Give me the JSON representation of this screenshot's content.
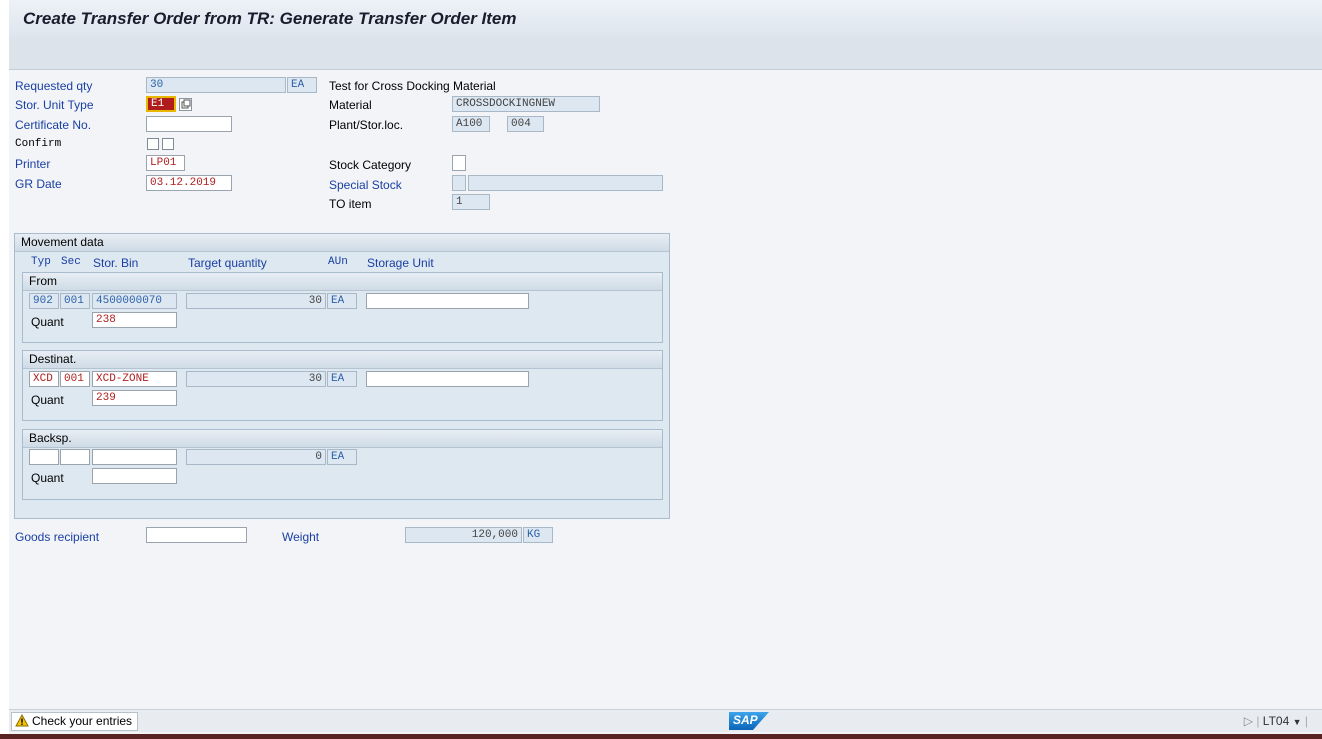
{
  "window": {
    "title": "Create Transfer Order from TR: Generate Transfer Order Item"
  },
  "header": {
    "requested_qty_label": "Requested qty",
    "requested_qty_value": "30",
    "requested_qty_unit": "EA",
    "material_description": "Test  for Cross Docking Material",
    "stor_unit_type_label": "Stor. Unit Type",
    "stor_unit_type_value": "E1",
    "certificate_label": "Certificate No.",
    "certificate_value": "",
    "confirm_label": "Confirm",
    "printer_label": "Printer",
    "printer_value": "LP01",
    "gr_date_label": "GR Date",
    "gr_date_value": "03.12.2019",
    "material_label": "Material",
    "material_value": "CROSSDOCKINGNEW",
    "plant_label": "Plant/Stor.loc.",
    "plant_value": "A100",
    "stor_loc_value": "004",
    "stock_category_label": "Stock Category",
    "special_stock_label": "Special Stock",
    "to_item_label": "TO item",
    "to_item_value": "1"
  },
  "movement": {
    "title": "Movement data",
    "columns": {
      "typ": "Typ",
      "sec": "Sec",
      "bin": "Stor. Bin",
      "target_qty": "Target quantity",
      "aun": "AUn",
      "storage_unit": "Storage Unit"
    },
    "from": {
      "title": "From",
      "typ": "902",
      "sec": "001",
      "bin": "4500000070",
      "qty": "30",
      "unit": "EA",
      "quant_label": "Quant",
      "quant": "238"
    },
    "dest": {
      "title": "Destinat.",
      "typ": "XCD",
      "sec": "001",
      "bin": "XCD-ZONE",
      "qty": "30",
      "unit": "EA",
      "quant_label": "Quant",
      "quant": "239"
    },
    "back": {
      "title": "Backsp.",
      "qty": "0",
      "unit": "EA",
      "quant_label": "Quant"
    }
  },
  "footer": {
    "goods_recipient_label": "Goods recipient",
    "weight_label": "Weight",
    "weight_value": "120,000",
    "weight_unit": "KG"
  },
  "statusbar": {
    "message": "Check your entries",
    "logo_text": "SAP",
    "tcode": "LT04"
  },
  "colors": {
    "accent_blue": "#1a3fa3",
    "field_red": "#b02020",
    "group_bg": "#dde8f1"
  }
}
